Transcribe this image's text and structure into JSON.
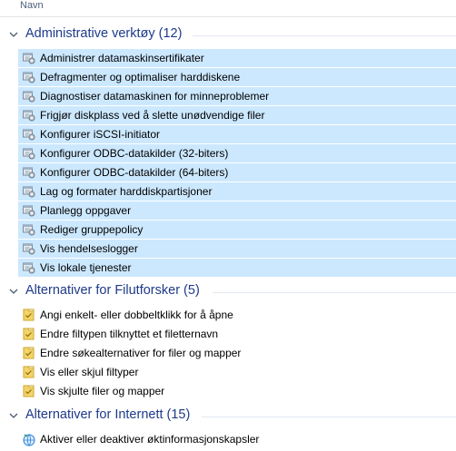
{
  "column_header": {
    "name": "Navn"
  },
  "groups": [
    {
      "title": "Administrative verktøy (12)",
      "icon": "admin-tool-icon",
      "items": [
        "Administrer datamaskinsertifikater",
        "Defragmenter og optimaliser harddiskene",
        "Diagnostiser datamaskinen for minneproblemer",
        "Frigjør diskplass ved å slette unødvendige filer",
        "Konfigurer iSCSI-initiator",
        "Konfigurer ODBC-datakilder (32-biters)",
        "Konfigurer ODBC-datakilder (64-biters)",
        "Lag og formater harddiskpartisjoner",
        "Planlegg oppgaver",
        "Rediger gruppepolicy",
        "Vis hendelseslogger",
        "Vis lokale tjenester"
      ]
    },
    {
      "title": "Alternativer for Filutforsker (5)",
      "icon": "folder-options-icon",
      "items": [
        "Angi enkelt- eller dobbeltklikk for å åpne",
        "Endre filtypen tilknyttet et filetternavn",
        "Endre søkealternativer for filer og mapper",
        "Vis eller skjul filtyper",
        "Vis skjulte filer og mapper"
      ]
    },
    {
      "title": "Alternativer for Internett (15)",
      "icon": "internet-options-icon",
      "items": [
        "Aktiver eller deaktiver øktinformasjonskapsler"
      ]
    }
  ],
  "colors": {
    "selection": "#cce8ff",
    "group_title": "#1e3a8a"
  }
}
